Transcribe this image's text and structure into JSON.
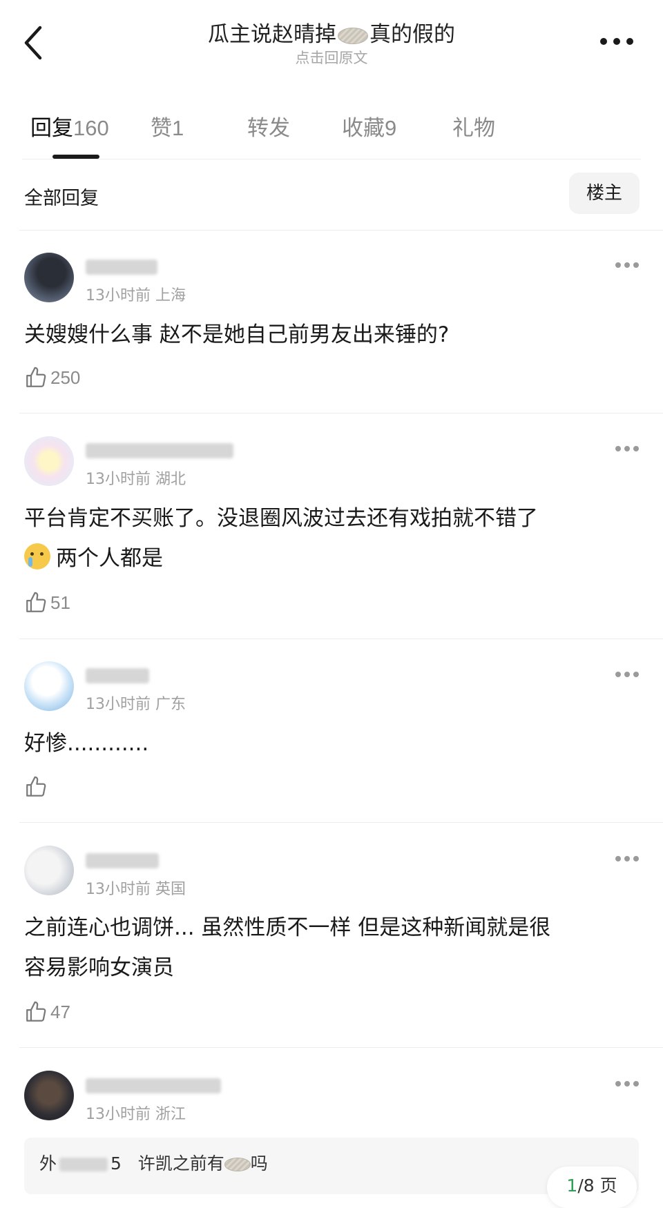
{
  "header": {
    "title_before": "瓜主说赵晴掉",
    "title_after": "真的假的",
    "subtitle": "点击回原文"
  },
  "tabs": [
    {
      "label": "回复",
      "count": "160"
    },
    {
      "label": "赞",
      "count": "1"
    },
    {
      "label": "转发",
      "count": ""
    },
    {
      "label": "收藏",
      "count": "9"
    },
    {
      "label": "礼物",
      "count": ""
    }
  ],
  "filter": {
    "all_replies_label": "全部回复",
    "owner_label": "楼主"
  },
  "comments": [
    {
      "time": "13小时前",
      "location": "上海",
      "content": "关嫂嫂什么事 赵不是她自己前男友出来锤的?",
      "likes": "250"
    },
    {
      "time": "13小时前",
      "location": "湖北",
      "content_line1": "平台肯定不买账了。没退圈风波过去还有戏拍就不错了",
      "content_line2": "两个人都是",
      "likes": "51"
    },
    {
      "time": "13小时前",
      "location": "广东",
      "content": "好惨............",
      "likes": ""
    },
    {
      "time": "13小时前",
      "location": "英国",
      "content_line1": "之前连心也调饼... 虽然性质不一样 但是这种新闻就是很",
      "content_line2": "容易影响女演员",
      "likes": "47"
    },
    {
      "time": "13小时前",
      "location": "浙江"
    }
  ],
  "sub_reply": {
    "prefix": "外",
    "suffix": "5",
    "text_before": "许凯之前有",
    "text_after": "吗"
  },
  "pagination": {
    "current": "1",
    "total_text": "/8 页"
  },
  "icons": {
    "back": "chevron-left-icon",
    "more": "more-horizontal-icon",
    "like": "thumbs-up-icon"
  }
}
